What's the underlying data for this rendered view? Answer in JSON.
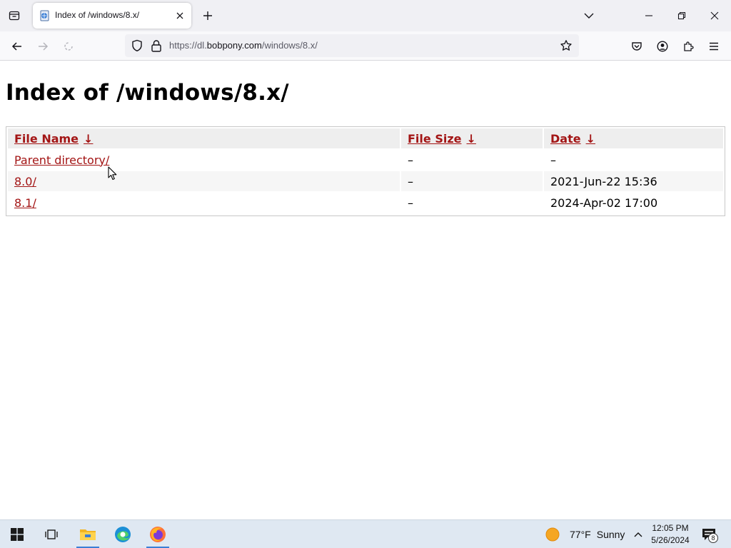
{
  "browser": {
    "tab": {
      "title": "Index of /windows/8.x/"
    },
    "url": {
      "prefix": "https://dl.",
      "host": "bobpony.com",
      "path": "/windows/8.x/"
    }
  },
  "page": {
    "title": "Index of /windows/8.x/",
    "columns": [
      {
        "label": "File Name",
        "sort_arrow": "↓"
      },
      {
        "label": "File Size",
        "sort_arrow": "↓"
      },
      {
        "label": "Date",
        "sort_arrow": "↓"
      }
    ],
    "rows": [
      {
        "name": "Parent directory/",
        "size": "–",
        "date": "–"
      },
      {
        "name": "8.0/",
        "size": "–",
        "date": "2021-Jun-22 15:36"
      },
      {
        "name": "8.1/",
        "size": "–",
        "date": "2024-Apr-02 17:00"
      }
    ],
    "link_color": "#a31515"
  },
  "taskbar": {
    "weather": {
      "temp": "77°F",
      "condition": "Sunny"
    },
    "clock": {
      "time": "12:05 PM",
      "date": "5/26/2024"
    },
    "notification_count": "8",
    "accent": "#3b7fd6"
  },
  "icons": [
    "tab-list-icon",
    "site-favicon-icon",
    "close-icon",
    "plus-icon",
    "chevron-down-icon",
    "minimize-icon",
    "restore-icon",
    "close-window-icon",
    "back-icon",
    "forward-icon",
    "reload-icon",
    "shield-icon",
    "lock-icon",
    "star-icon",
    "pocket-icon",
    "account-icon",
    "extensions-icon",
    "menu-icon",
    "windows-start-icon",
    "task-view-icon",
    "file-explorer-icon",
    "edge-icon",
    "firefox-icon",
    "sun-icon",
    "chevron-up-icon",
    "notification-icon"
  ]
}
